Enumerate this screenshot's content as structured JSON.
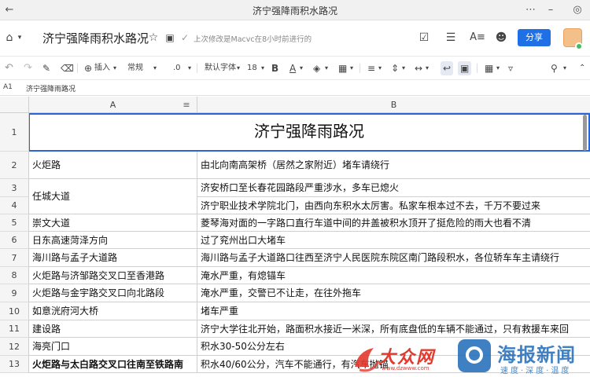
{
  "window": {
    "title": "济宁强降雨积水路况"
  },
  "doc": {
    "title": "济宁强降雨积水路况",
    "status": "上次修改是Macvc在8小时前进行的",
    "share_label": "分享"
  },
  "toolbar": {
    "insert_label": "插入",
    "format_label": "常规",
    "decimal_label": ".0",
    "font_label": "默认字体",
    "size_label": "18"
  },
  "formula": {
    "cell_ref": "A1",
    "content": "济宁强降雨路况"
  },
  "columns": [
    "A",
    "B"
  ],
  "sheet": {
    "header": "济宁强降雨路况",
    "rows": [
      {
        "num": "2",
        "a": "火炬路",
        "b": "由北向南高架桥（居然之家附近）堵车请绕行"
      },
      {
        "num": "3",
        "a": "任城大道",
        "b": "济安桥口至长春花园路段严重涉水，多车已熄火"
      },
      {
        "num": "4",
        "a": "",
        "b": "济宁职业技术学院北门，由西向东积水太厉害。私家车根本过不去，千万不要过来"
      },
      {
        "num": "5",
        "a": "崇文大道",
        "b": "菱琴海对面的一字路口直行车道中间的井盖被积水顶开了挺危险的雨大也看不清"
      },
      {
        "num": "6",
        "a": "日东高速菏泽方向",
        "b": "过了兖州出口大堵车"
      },
      {
        "num": "7",
        "a": "海川路与孟子大道路",
        "b": "海川路与孟子大道路口往西至济宁人民医院东院区南门路段积水，各位轿车车主请绕行"
      },
      {
        "num": "8",
        "a": "火炬路与济邹路交叉口至香港路",
        "b": "淹水严重，有熄锚车"
      },
      {
        "num": "9",
        "a": "火炬路与金宇路交叉口向北路段",
        "b": "淹水严重，交警已不让走，在往外拖车"
      },
      {
        "num": "10",
        "a": "如意洸府河大桥",
        "b": "堵车严重"
      },
      {
        "num": "11",
        "a": "建设路",
        "b": "济宁大学往北开始，路面积水接近一米深，所有底盘低的车辆不能通过，只有救援车来回"
      },
      {
        "num": "12",
        "a": "海亮门口",
        "b": "积水30-50公分左右"
      },
      {
        "num": "13",
        "a": "火炬路与太白路交叉口往南至铁路南",
        "b": "积水40/60公分，汽车不能通行，有汽车抛锚"
      }
    ]
  },
  "watermarks": {
    "dazhong": "大众网",
    "dazhong_url": "www.dzwww.com",
    "haiba": "海报新闻",
    "haiba_sub": "速度·深度·温度"
  },
  "colors": {
    "accent": "#1f6fe5",
    "selection": "#2a64d6",
    "watermark_red": "#e23a2f",
    "watermark_blue": "#1e6ab8"
  }
}
